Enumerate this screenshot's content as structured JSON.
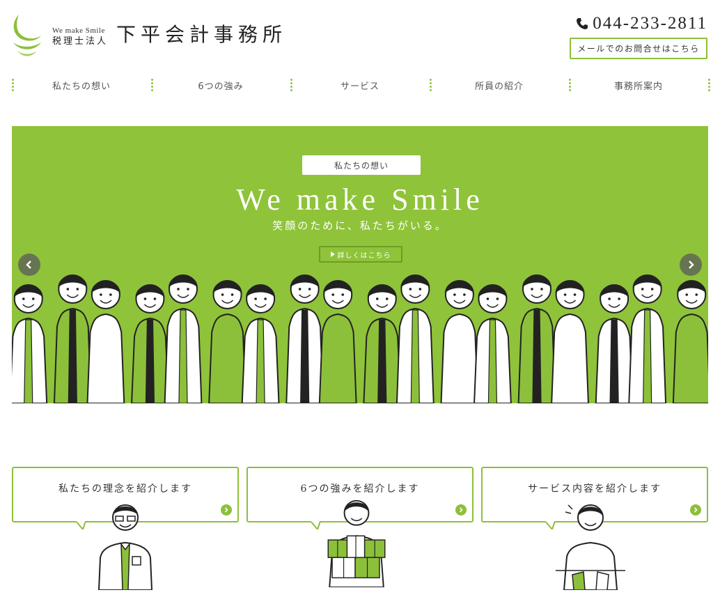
{
  "header": {
    "logo_tagline": "We make Smile",
    "logo_corp_type": "税理士法人",
    "logo_name": "下平会計事務所",
    "phone": "044-233-2811",
    "mail_button": "メールでのお問合せはこちら"
  },
  "nav": {
    "items": [
      {
        "label": "私たちの想い"
      },
      {
        "label": "6つの強み"
      },
      {
        "label": "サービス"
      },
      {
        "label": "所員の紹介"
      },
      {
        "label": "事務所案内"
      }
    ]
  },
  "hero": {
    "badge": "私たちの想い",
    "title": "We make Smile",
    "subtitle": "笑顔のために、私たちがいる。",
    "button": "詳しくはこちら"
  },
  "cards": [
    {
      "title": "私たちの理念を紹介します"
    },
    {
      "title": "6つの強みを紹介します"
    },
    {
      "title": "サービス内容を紹介します"
    }
  ],
  "colors": {
    "brand_green": "#8cc03a",
    "hero_green": "#8fc33a",
    "text": "#333333"
  },
  "icons": {
    "phone": "phone-icon",
    "prev": "chevron-left-icon",
    "next": "chevron-right-icon",
    "card_go": "chevron-right-circle-icon"
  }
}
